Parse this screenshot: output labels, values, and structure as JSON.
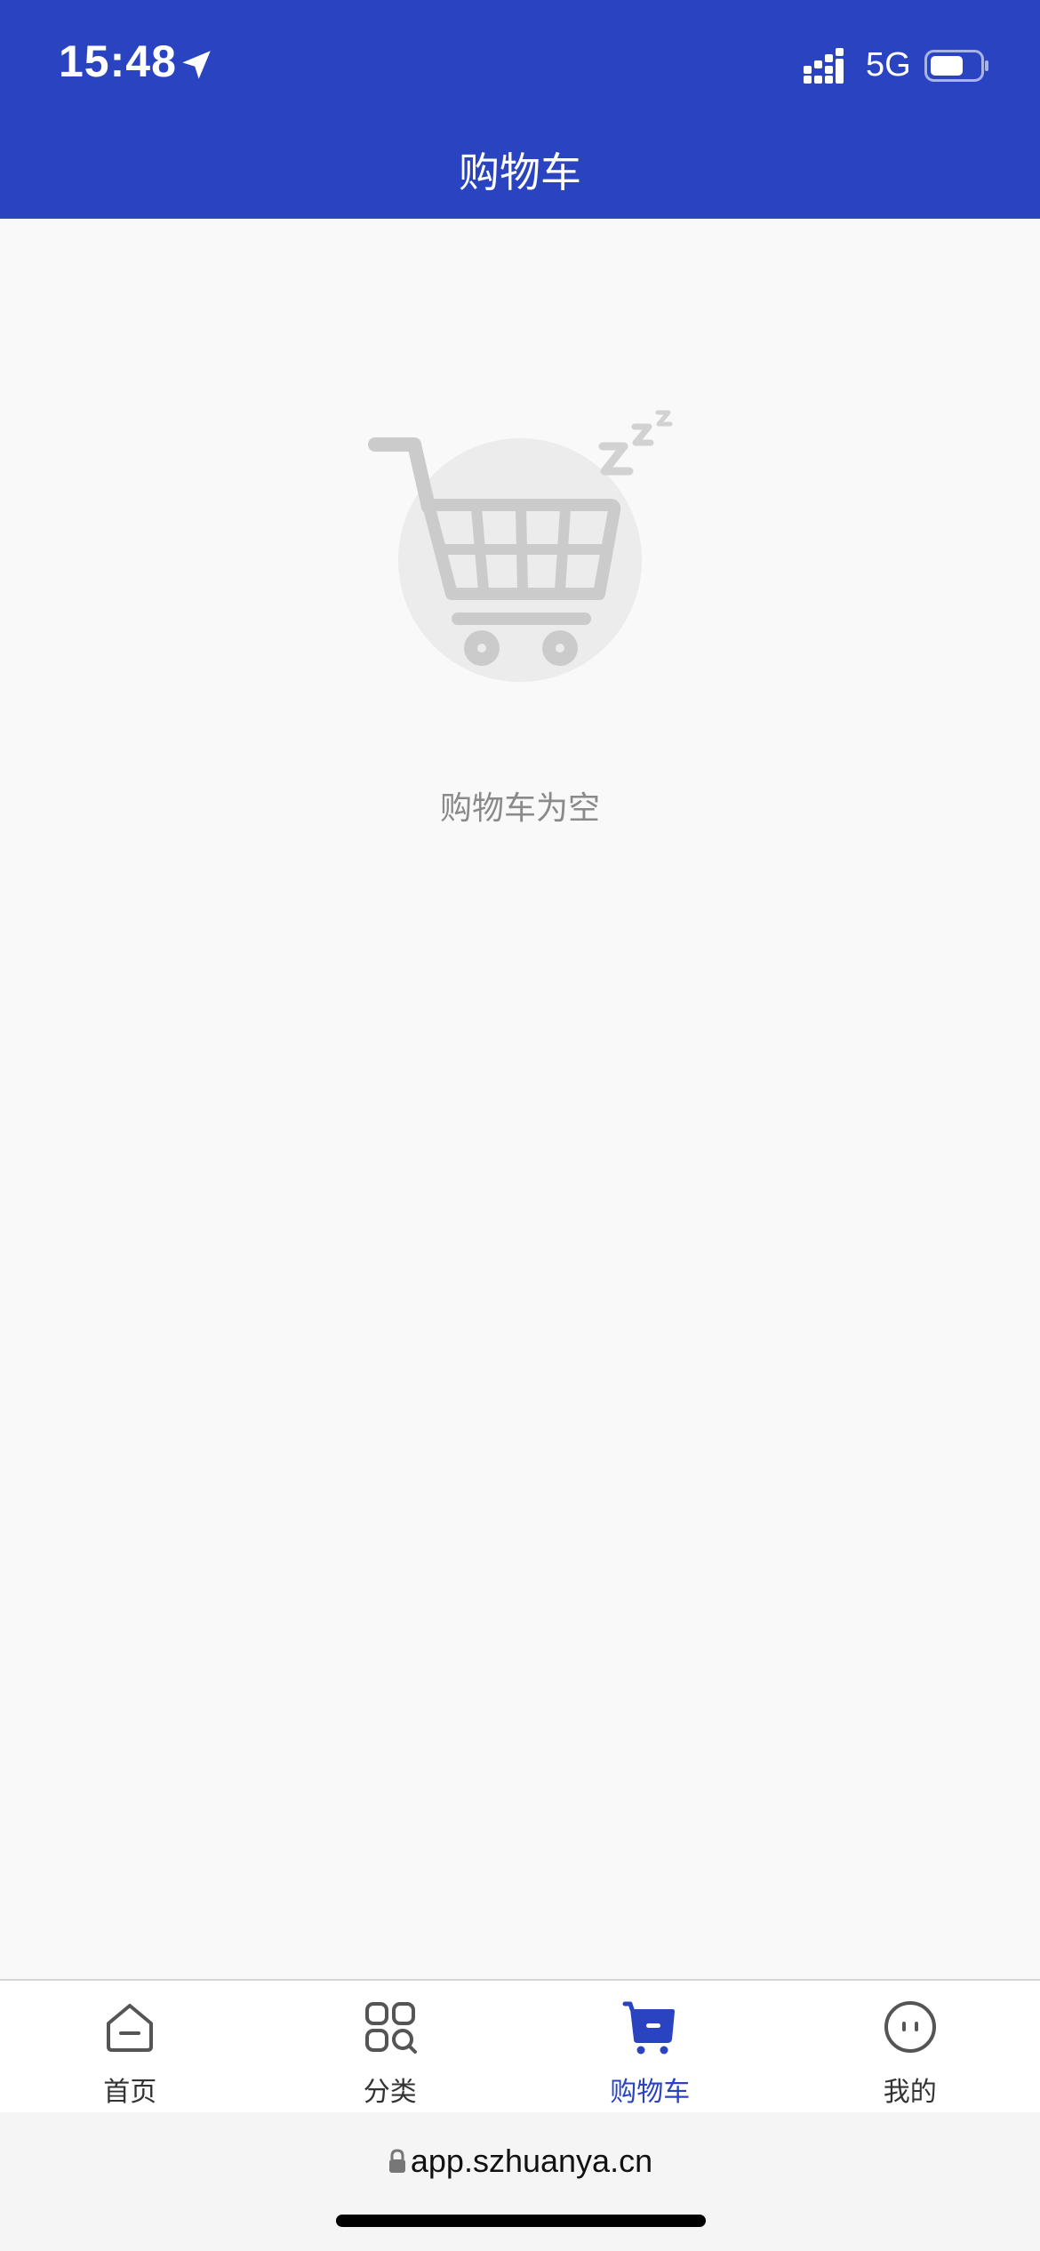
{
  "status_bar": {
    "time": "15:48",
    "network": "5G",
    "icons": [
      "location-arrow-icon",
      "signal-icon",
      "battery-icon"
    ]
  },
  "nav": {
    "title": "购物车"
  },
  "empty_state": {
    "illustration": "sleeping-cart-icon",
    "message": "购物车为空"
  },
  "tab_bar": {
    "items": [
      {
        "label": "首页",
        "icon": "home-icon",
        "active": false
      },
      {
        "label": "分类",
        "icon": "category-icon",
        "active": false
      },
      {
        "label": "购物车",
        "icon": "cart-icon",
        "active": true
      },
      {
        "label": "我的",
        "icon": "profile-icon",
        "active": false
      }
    ]
  },
  "browser": {
    "url": "app.szhuanya.cn"
  },
  "colors": {
    "primary": "#2a44c1",
    "background": "#f9f9f9",
    "muted_text": "#8a8a8a"
  }
}
